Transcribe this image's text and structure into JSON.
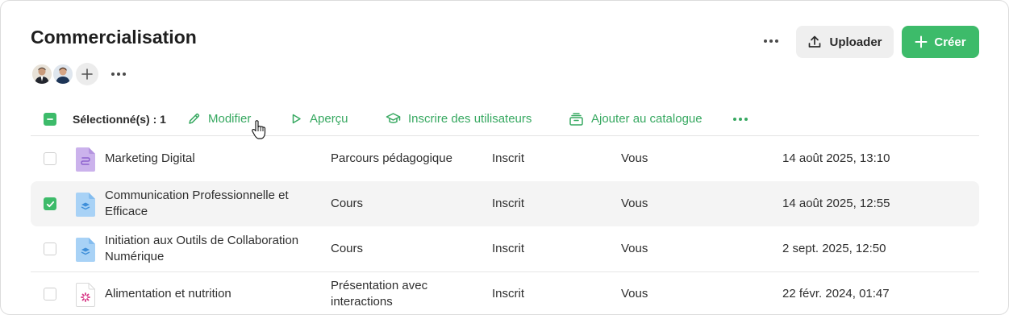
{
  "page": {
    "title": "Commercialisation",
    "upload_label": "Uploader",
    "create_label": "Créer",
    "brand_color": "#3dbb6a"
  },
  "toolbar": {
    "selected_label": "Sélectionné(s) : 1",
    "edit_label": "Modifier",
    "preview_label": "Aperçu",
    "enroll_label": "Inscrire des utilisateurs",
    "catalog_label": "Ajouter au catalogue"
  },
  "rows": [
    {
      "name": "Marketing Digital",
      "type": "Parcours pédagogique",
      "status": "Inscrit",
      "owner": "Vous",
      "date": "14 août 2025, 13:10",
      "icon": "learning-path-icon",
      "checked": false
    },
    {
      "name": "Communication Professionnelle et Efficace",
      "type": "Cours",
      "status": "Inscrit",
      "owner": "Vous",
      "date": "14 août 2025, 12:55",
      "icon": "course-icon",
      "checked": true
    },
    {
      "name": "Initiation aux Outils de Collaboration Numérique",
      "type": "Cours",
      "status": "Inscrit",
      "owner": "Vous",
      "date": "2 sept. 2025, 12:50",
      "icon": "course-icon",
      "checked": false
    },
    {
      "name": "Alimentation et nutrition",
      "type": "Présentation avec interactions",
      "status": "Inscrit",
      "owner": "Vous",
      "date": "22 févr. 2024, 01:47",
      "icon": "interactive-presentation-icon",
      "checked": false
    }
  ]
}
